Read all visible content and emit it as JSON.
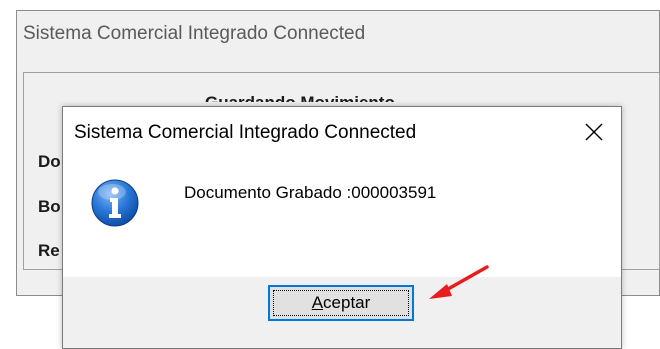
{
  "background_window": {
    "title": "Sistema Comercial Integrado Connected",
    "heading": "Guardando Movimiento",
    "labels": [
      "Do",
      "Bo",
      "Re"
    ]
  },
  "dialog": {
    "title": "Sistema Comercial Integrado Connected",
    "close_icon": "close-x",
    "icon": "information-icon",
    "message": "Documento Grabado :000003591",
    "ok_button": {
      "accelerator": "A",
      "rest": "ceptar",
      "label": "Aceptar"
    }
  },
  "annotation": {
    "arrow_color": "#e81c1c"
  },
  "colors": {
    "accent": "#0078d7",
    "info_blue": "#1f6fd1"
  }
}
